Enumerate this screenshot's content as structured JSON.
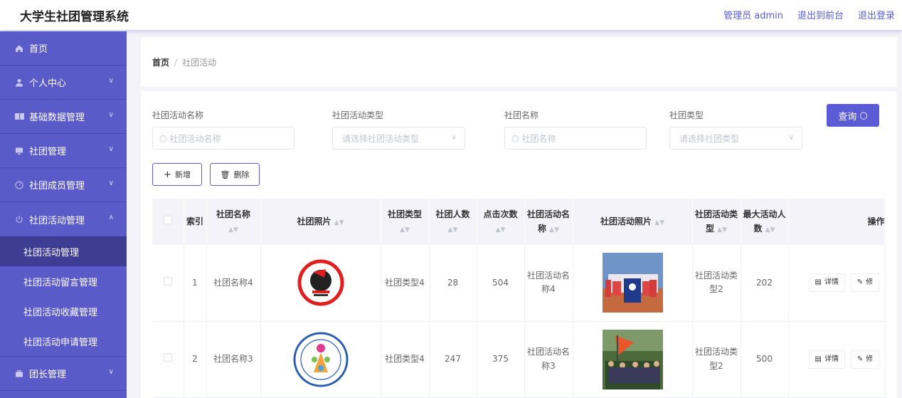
{
  "header": {
    "title": "大学生社团管理系统",
    "admin_label": "管理员 admin",
    "to_front": "退出到前台",
    "logout": "退出登录"
  },
  "sidebar": {
    "items": [
      {
        "label": "首页",
        "icon": "home-icon"
      },
      {
        "label": "个人中心",
        "icon": "user-icon"
      },
      {
        "label": "基础数据管理",
        "icon": "data-icon"
      },
      {
        "label": "社团管理",
        "icon": "monitor-icon"
      },
      {
        "label": "社团成员管理",
        "icon": "compass-icon"
      },
      {
        "label": "社团活动管理",
        "icon": "power-icon"
      },
      {
        "label": "团长管理",
        "icon": "briefcase-icon"
      }
    ],
    "sub_items": [
      {
        "label": "社团活动管理",
        "active": true
      },
      {
        "label": "社团活动留言管理",
        "active": false
      },
      {
        "label": "社团活动收藏管理",
        "active": false
      },
      {
        "label": "社团活动申请管理",
        "active": false
      }
    ]
  },
  "breadcrumb": {
    "home": "首页",
    "separator": "/",
    "current": "社团活动"
  },
  "filters": {
    "activity_name": {
      "label": "社团活动名称",
      "placeholder": "社团活动名称"
    },
    "activity_type": {
      "label": "社团活动类型",
      "placeholder": "请选择社团活动类型"
    },
    "club_name": {
      "label": "社团名称",
      "placeholder": "社团名称"
    },
    "club_type": {
      "label": "社团类型",
      "placeholder": "请选择社团类型"
    },
    "query_button": "查询"
  },
  "actions": {
    "add": "新增",
    "delete": "删除"
  },
  "table": {
    "headers": {
      "index": "索引",
      "club_name": "社团名称",
      "club_photo": "社团照片",
      "club_type": "社团类型",
      "members": "社团人数",
      "clicks": "点击次数",
      "activity_name": "社团活动名称",
      "activity_photo": "社团活动照片",
      "activity_type": "社团活动类型",
      "max_people": "最大活动人数",
      "ops": "操作"
    },
    "rows": [
      {
        "index": "1",
        "club_name": "社团名称4",
        "club_type": "社团类型4",
        "members": "28",
        "clicks": "504",
        "activity_name": "社团活动名称4",
        "activity_type": "社团活动类型2",
        "max_people": "202"
      },
      {
        "index": "2",
        "club_name": "社团名称3",
        "club_type": "社团类型4",
        "members": "247",
        "clicks": "375",
        "activity_name": "社团活动名称3",
        "activity_type": "社团活动类型2",
        "max_people": "500"
      }
    ],
    "op_detail": "详情",
    "op_edit": "修"
  },
  "colors": {
    "accent": "#5b5bd6",
    "sidebar": "#5a5ac8",
    "sidebar_active": "#3d3d94"
  }
}
